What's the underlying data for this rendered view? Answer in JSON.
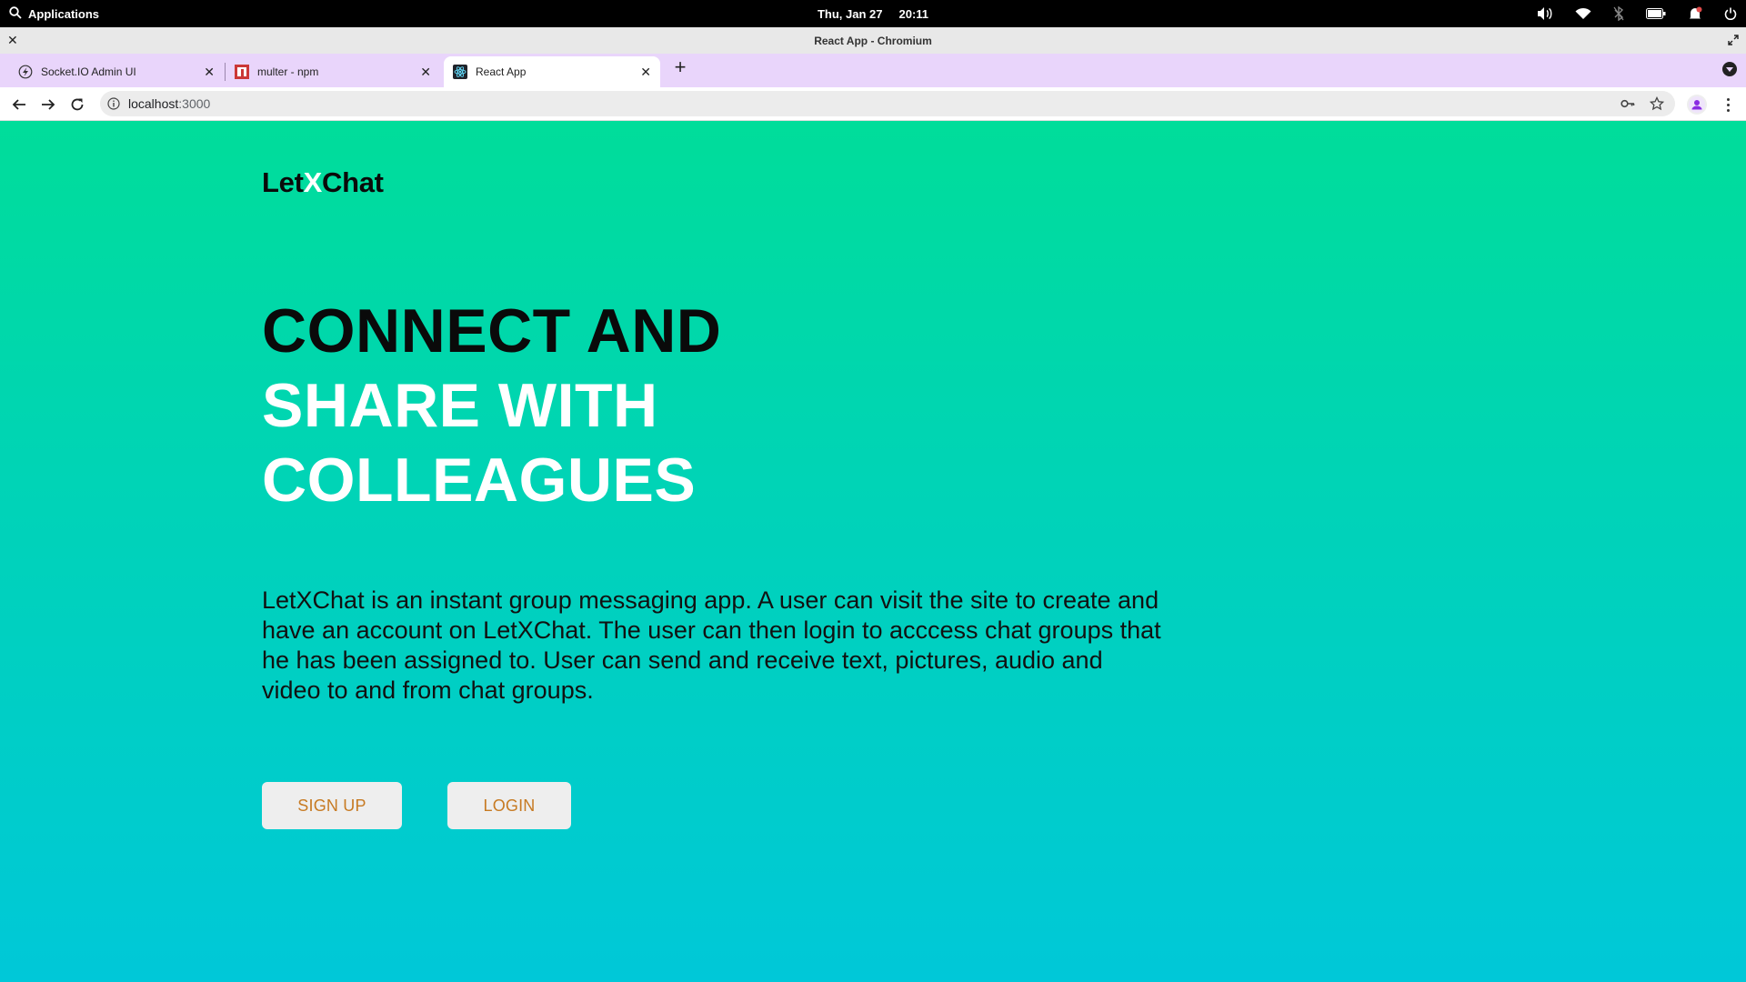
{
  "system_bar": {
    "applications_label": "Applications",
    "date": "Thu, Jan 27",
    "time": "20:11"
  },
  "window": {
    "title": "React App - Chromium"
  },
  "tabs": [
    {
      "label": "Socket.IO Admin UI",
      "icon": "socketio-favicon-icon"
    },
    {
      "label": "multer - npm",
      "icon": "npm-favicon-icon"
    },
    {
      "label": "React App",
      "icon": "react-favicon-icon",
      "active": true
    }
  ],
  "address_bar": {
    "host": "localhost",
    "port": ":3000"
  },
  "page": {
    "logo": {
      "part1": "Let",
      "part2": "X",
      "part3": "Chat"
    },
    "headline": {
      "line1": "CONNECT AND",
      "line2": "SHARE WITH",
      "line3": "COLLEAGUES"
    },
    "description": "LetXChat is an instant group messaging app. A user can visit the site to create and have an account on LetXChat. The user can then login to acccess chat groups that he has been assigned to. User can send and receive text, pictures, audio and video to and from chat groups.",
    "signup_label": "SIGN UP",
    "login_label": "LOGIN"
  },
  "colors": {
    "gradient_top": "#00dd9a",
    "gradient_bottom": "#00c8d8",
    "button_text": "#c77a22",
    "tabstrip": "#e9d5fb"
  }
}
